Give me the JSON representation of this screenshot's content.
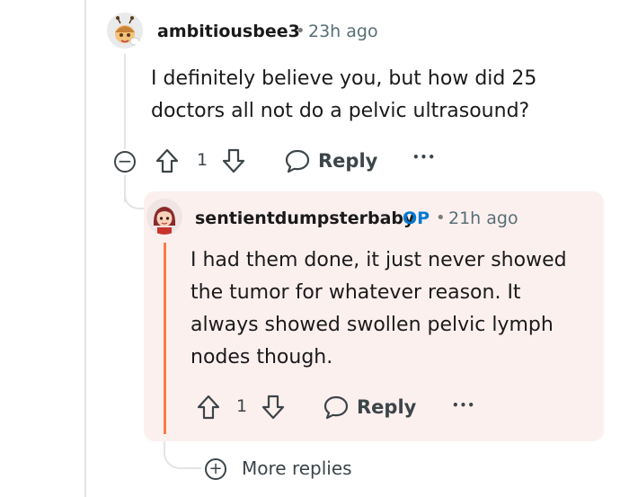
{
  "comment1": {
    "username": "ambitiousbee3",
    "separator": "•",
    "time": "23h ago",
    "lines": [
      "I definitely believe you, but how did 25",
      "doctors all not do a pelvic ultrasound?"
    ],
    "vote_count": "1",
    "reply_label": "Reply",
    "more_label": "•••",
    "collapse_label": "−"
  },
  "comment2": {
    "username": "sentientdumpsterbaby",
    "op_badge": "OP",
    "separator": "•",
    "time": "21h ago",
    "lines": [
      "I had them done, it just never showed",
      "the tumor for whatever reason. It",
      "always showed swollen pelvic lymph",
      "nodes though."
    ],
    "vote_count": "1",
    "reply_label": "Reply",
    "more_label": "•••"
  },
  "more_replies": {
    "icon_label": "+",
    "label": "More replies"
  },
  "colors": {
    "highlight_bg": "#fcf0ef",
    "op_blue": "#0079d3",
    "accent_orange": "#ff4500"
  }
}
